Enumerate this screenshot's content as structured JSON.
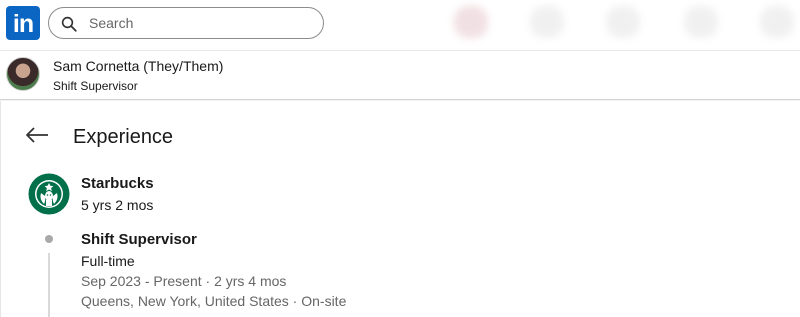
{
  "nav": {
    "logo_text": "in",
    "search_placeholder": "Search",
    "brand_color": "#0a66c2"
  },
  "profile": {
    "name": "Sam Cornetta",
    "pronouns": "(They/Them)",
    "headline": "Shift Supervisor"
  },
  "experience": {
    "title": "Experience",
    "company": {
      "name": "Starbucks",
      "duration": "5 yrs 2 mos",
      "logo_color": "#00704a"
    },
    "roles": [
      {
        "title": "Shift Supervisor",
        "type": "Full-time",
        "dates": "Sep 2023 - Present · 2 yrs 4 mos",
        "location": "Queens, New York, United States · On-site"
      }
    ]
  }
}
